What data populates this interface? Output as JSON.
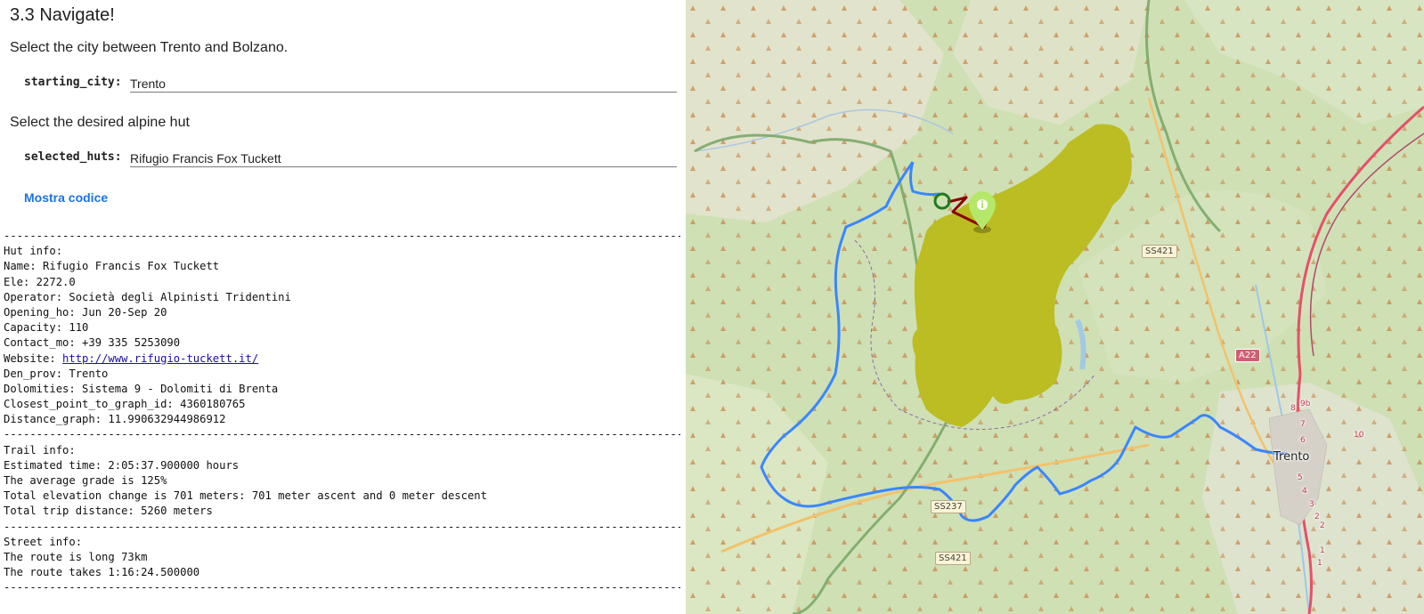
{
  "section": {
    "title": "3.3 Navigate!"
  },
  "prompts": {
    "city": "Select the city between Trento and Bolzano.",
    "hut": "Select the desired alpine hut"
  },
  "fields": {
    "starting_city": {
      "label": "starting_city:",
      "value": "Trento"
    },
    "selected_huts": {
      "label": "selected_huts:",
      "value": "Rifugio Francis Fox Tuckett"
    }
  },
  "show_code_label": "Mostra codice",
  "console": {
    "separator": "----------------------------------------------------------------------------------------------------------------------------------",
    "hut_info": [
      "Hut info:",
      "Name: Rifugio Francis Fox Tuckett",
      "Ele: 2272.0",
      "Operator: Società degli Alpinisti Tridentini",
      "Opening_ho: Jun 20-Sep 20",
      "Capacity: 110",
      "Contact_mo: +39 335 5253090"
    ],
    "website_prefix": "Website: ",
    "website_url": "http://www.rifugio-tuckett.it/",
    "hut_info_tail": [
      "Den_prov: Trento",
      "Dolomities: Sistema 9 - Dolomiti di Brenta",
      "Closest_point_to_graph_id: 4360180765",
      "Distance_graph: 11.990632944986912"
    ],
    "trail_info": [
      "Trail info:",
      "Estimated time: 2:05:37.900000 hours",
      "The average grade is 125%",
      "Total elevation change is 701 meters: 701 meter ascent and 0 meter descent",
      "Total trip distance: 5260 meters"
    ],
    "street_info": [
      "Street info:",
      "The route is long 73km",
      "The route takes 1:16:24.500000"
    ]
  },
  "map": {
    "city_label": "Trento",
    "road_labels": [
      "SS421",
      "SS237",
      "SS421"
    ],
    "motorway_label": "A22",
    "km_markers": [
      "9b",
      "8",
      "7",
      "6",
      "10",
      "5",
      "4",
      "3",
      "2",
      "2",
      "1",
      "1"
    ],
    "colors": {
      "route": "#3a86ff",
      "trail": "#8b0000",
      "start_marker": "#1f7a1f",
      "hut_marker": "#b5e86a",
      "dolomites_area": "#bcbd22",
      "motorway": "#e4506a"
    },
    "icons": {
      "hut_marker": "info-pin-icon",
      "start_marker": "circle-marker-icon"
    }
  }
}
